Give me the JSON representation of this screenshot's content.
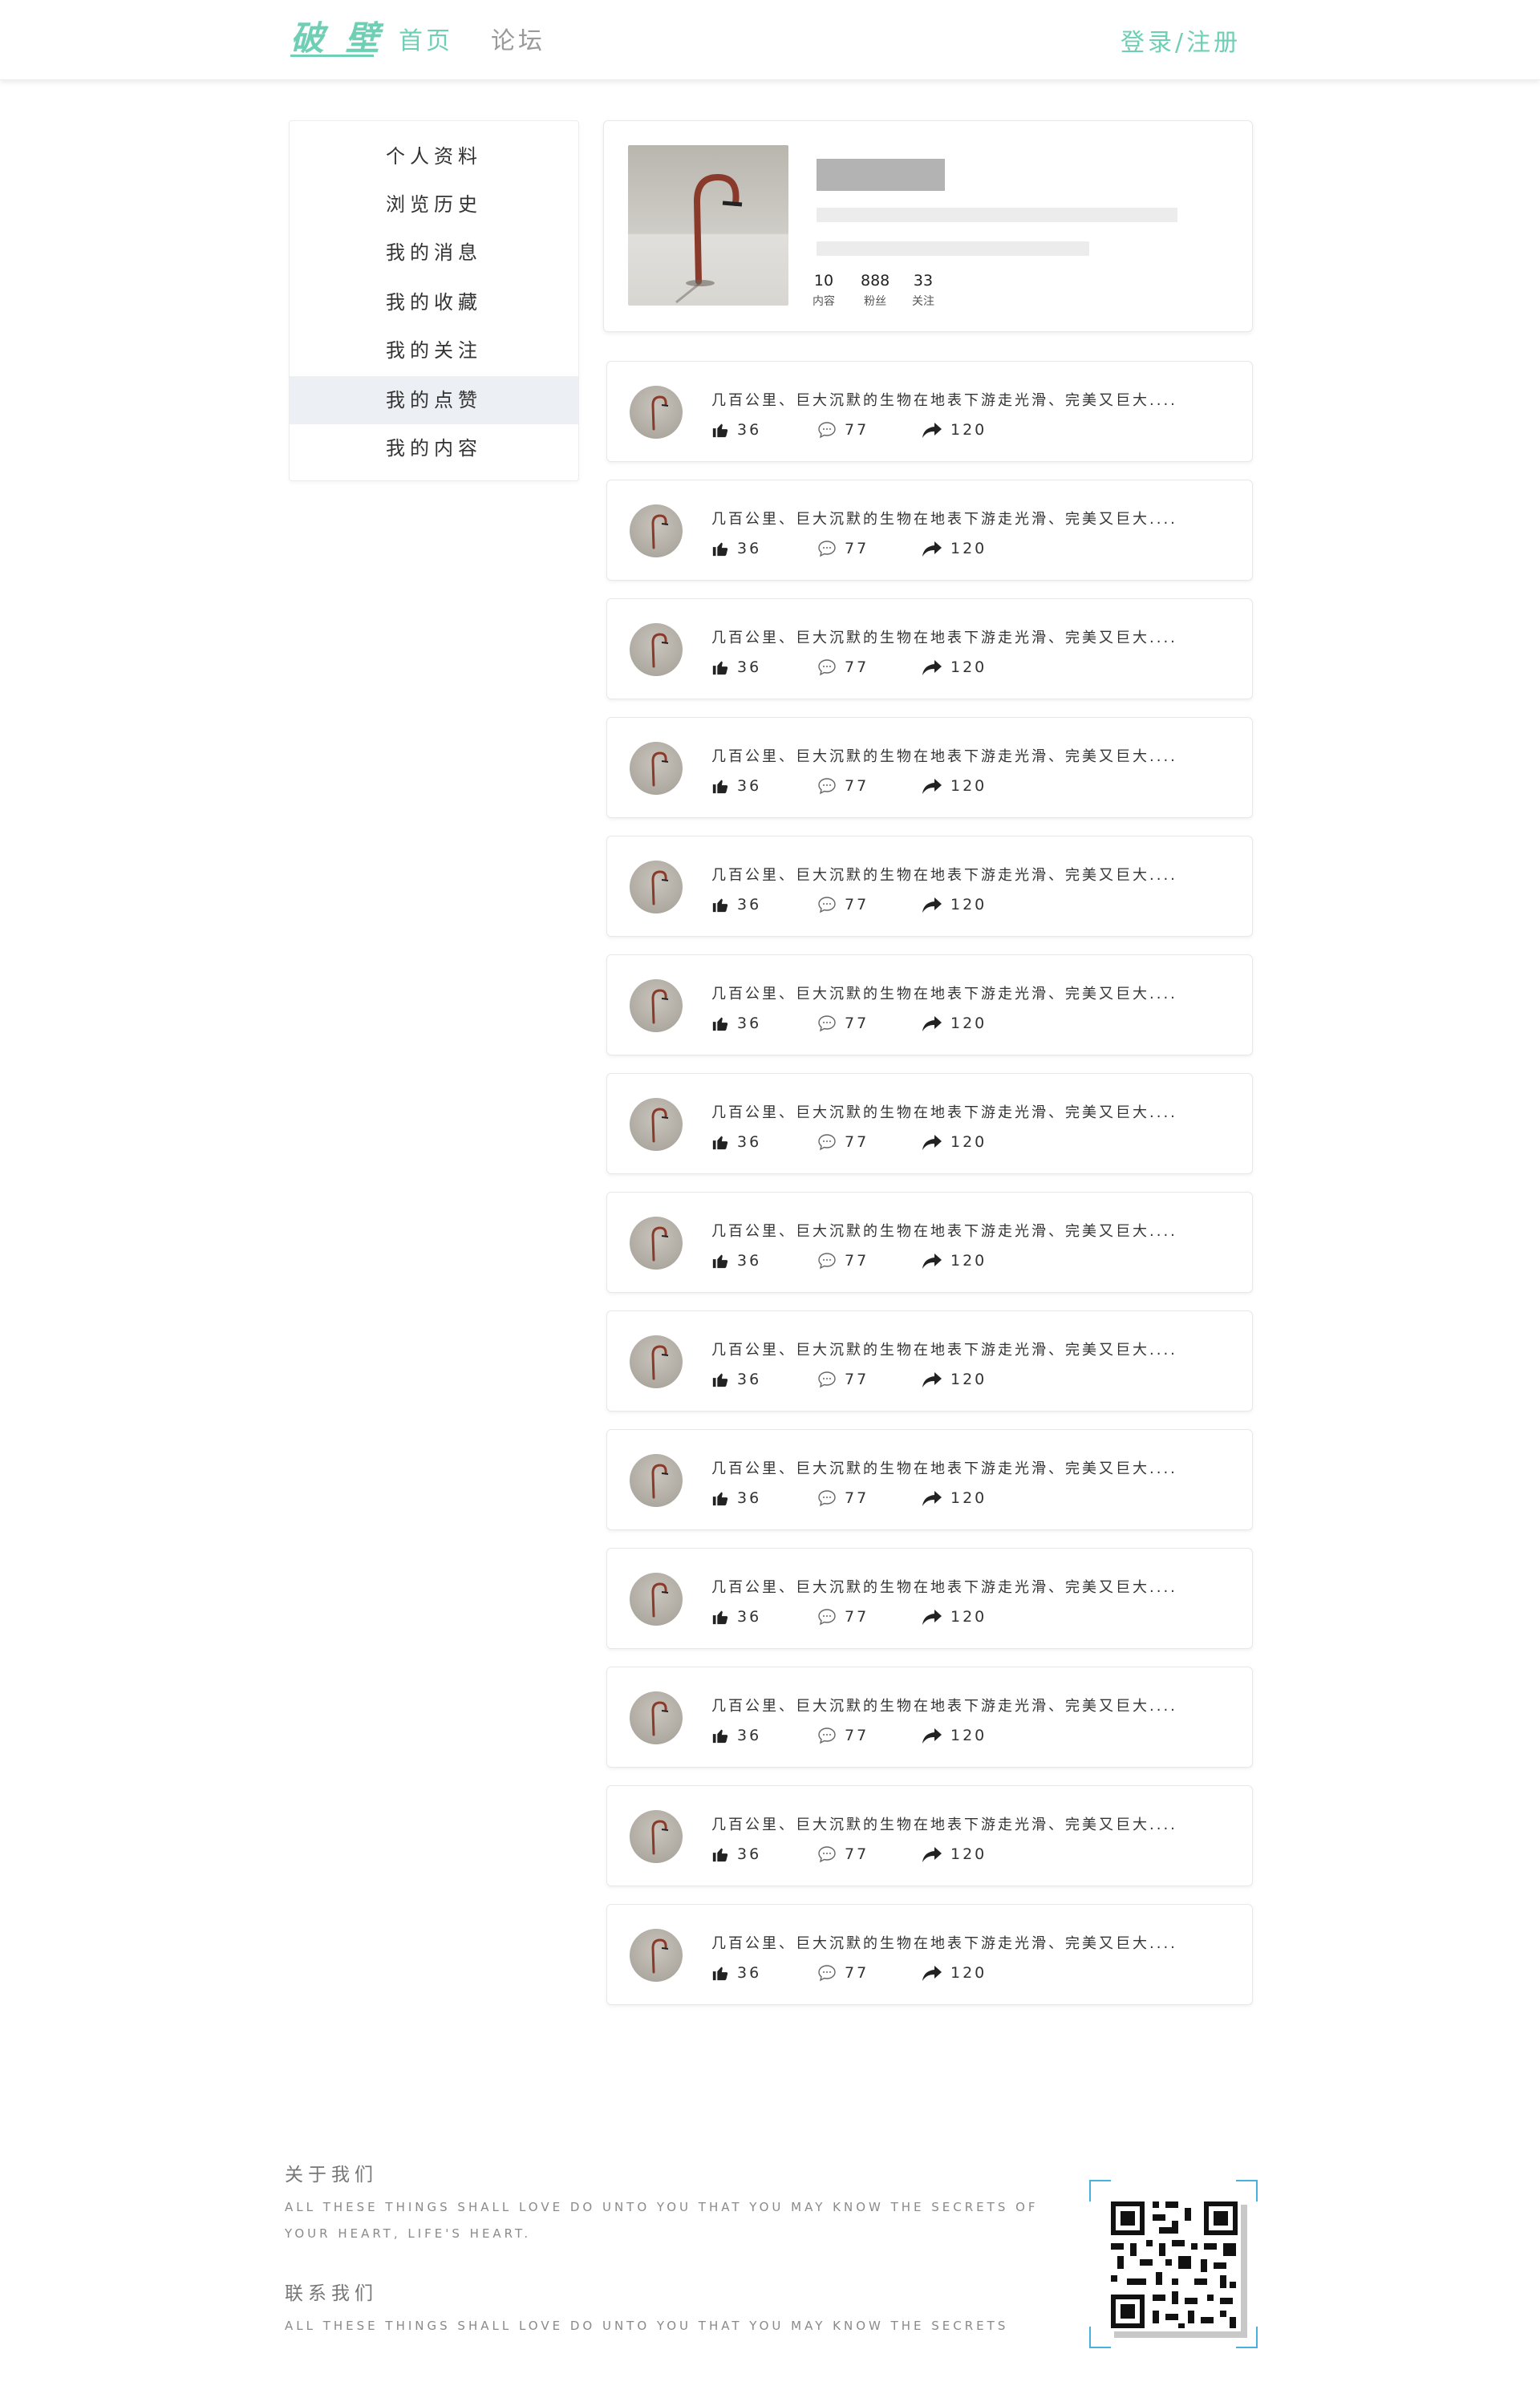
{
  "header": {
    "logo": "破 壁",
    "nav_home": "首页",
    "nav_forum": "论坛",
    "login": "登录/注册"
  },
  "sidebar": {
    "items": [
      {
        "label": "个人资料"
      },
      {
        "label": "浏览历史"
      },
      {
        "label": "我的消息"
      },
      {
        "label": "我的收藏"
      },
      {
        "label": "我的关注"
      },
      {
        "label": "我的点赞"
      },
      {
        "label": "我的内容"
      }
    ],
    "active_index": 5
  },
  "profile": {
    "stats": [
      {
        "value": "10",
        "label": "内容"
      },
      {
        "value": "888",
        "label": "粉丝"
      },
      {
        "value": "33",
        "label": "关注"
      }
    ]
  },
  "feed": {
    "items": [
      {
        "text": "几百公里、巨大沉默的生物在地表下游走光滑、完美又巨大....",
        "likes": "36",
        "comments": "77",
        "shares": "120"
      },
      {
        "text": "几百公里、巨大沉默的生物在地表下游走光滑、完美又巨大....",
        "likes": "36",
        "comments": "77",
        "shares": "120"
      },
      {
        "text": "几百公里、巨大沉默的生物在地表下游走光滑、完美又巨大....",
        "likes": "36",
        "comments": "77",
        "shares": "120"
      },
      {
        "text": "几百公里、巨大沉默的生物在地表下游走光滑、完美又巨大....",
        "likes": "36",
        "comments": "77",
        "shares": "120"
      },
      {
        "text": "几百公里、巨大沉默的生物在地表下游走光滑、完美又巨大....",
        "likes": "36",
        "comments": "77",
        "shares": "120"
      },
      {
        "text": "几百公里、巨大沉默的生物在地表下游走光滑、完美又巨大....",
        "likes": "36",
        "comments": "77",
        "shares": "120"
      },
      {
        "text": "几百公里、巨大沉默的生物在地表下游走光滑、完美又巨大....",
        "likes": "36",
        "comments": "77",
        "shares": "120"
      },
      {
        "text": "几百公里、巨大沉默的生物在地表下游走光滑、完美又巨大....",
        "likes": "36",
        "comments": "77",
        "shares": "120"
      },
      {
        "text": "几百公里、巨大沉默的生物在地表下游走光滑、完美又巨大....",
        "likes": "36",
        "comments": "77",
        "shares": "120"
      },
      {
        "text": "几百公里、巨大沉默的生物在地表下游走光滑、完美又巨大....",
        "likes": "36",
        "comments": "77",
        "shares": "120"
      },
      {
        "text": "几百公里、巨大沉默的生物在地表下游走光滑、完美又巨大....",
        "likes": "36",
        "comments": "77",
        "shares": "120"
      },
      {
        "text": "几百公里、巨大沉默的生物在地表下游走光滑、完美又巨大....",
        "likes": "36",
        "comments": "77",
        "shares": "120"
      },
      {
        "text": "几百公里、巨大沉默的生物在地表下游走光滑、完美又巨大....",
        "likes": "36",
        "comments": "77",
        "shares": "120"
      },
      {
        "text": "几百公里、巨大沉默的生物在地表下游走光滑、完美又巨大....",
        "likes": "36",
        "comments": "77",
        "shares": "120"
      }
    ]
  },
  "footer": {
    "about_title": "关于我们",
    "about_text_line1": "ALL THESE THINGS SHALL LOVE DO UNTO YOU THAT YOU MAY KNOW THE SECRETS OF",
    "about_text_line2": "YOUR HEART, LIFE'S HEART.",
    "contact_title": "联系我们",
    "contact_text": "ALL THESE THINGS SHALL LOVE DO UNTO YOU THAT YOU MAY KNOW THE SECRETS"
  },
  "colors": {
    "accent": "#6fcfb4",
    "muted_nav": "#9a9a9a",
    "active_bg": "#eceff3"
  },
  "icons": {
    "like": "thumbs-up-icon",
    "comment": "comment-bubble-icon",
    "share": "share-arrow-icon",
    "qr": "qr-code-icon"
  }
}
